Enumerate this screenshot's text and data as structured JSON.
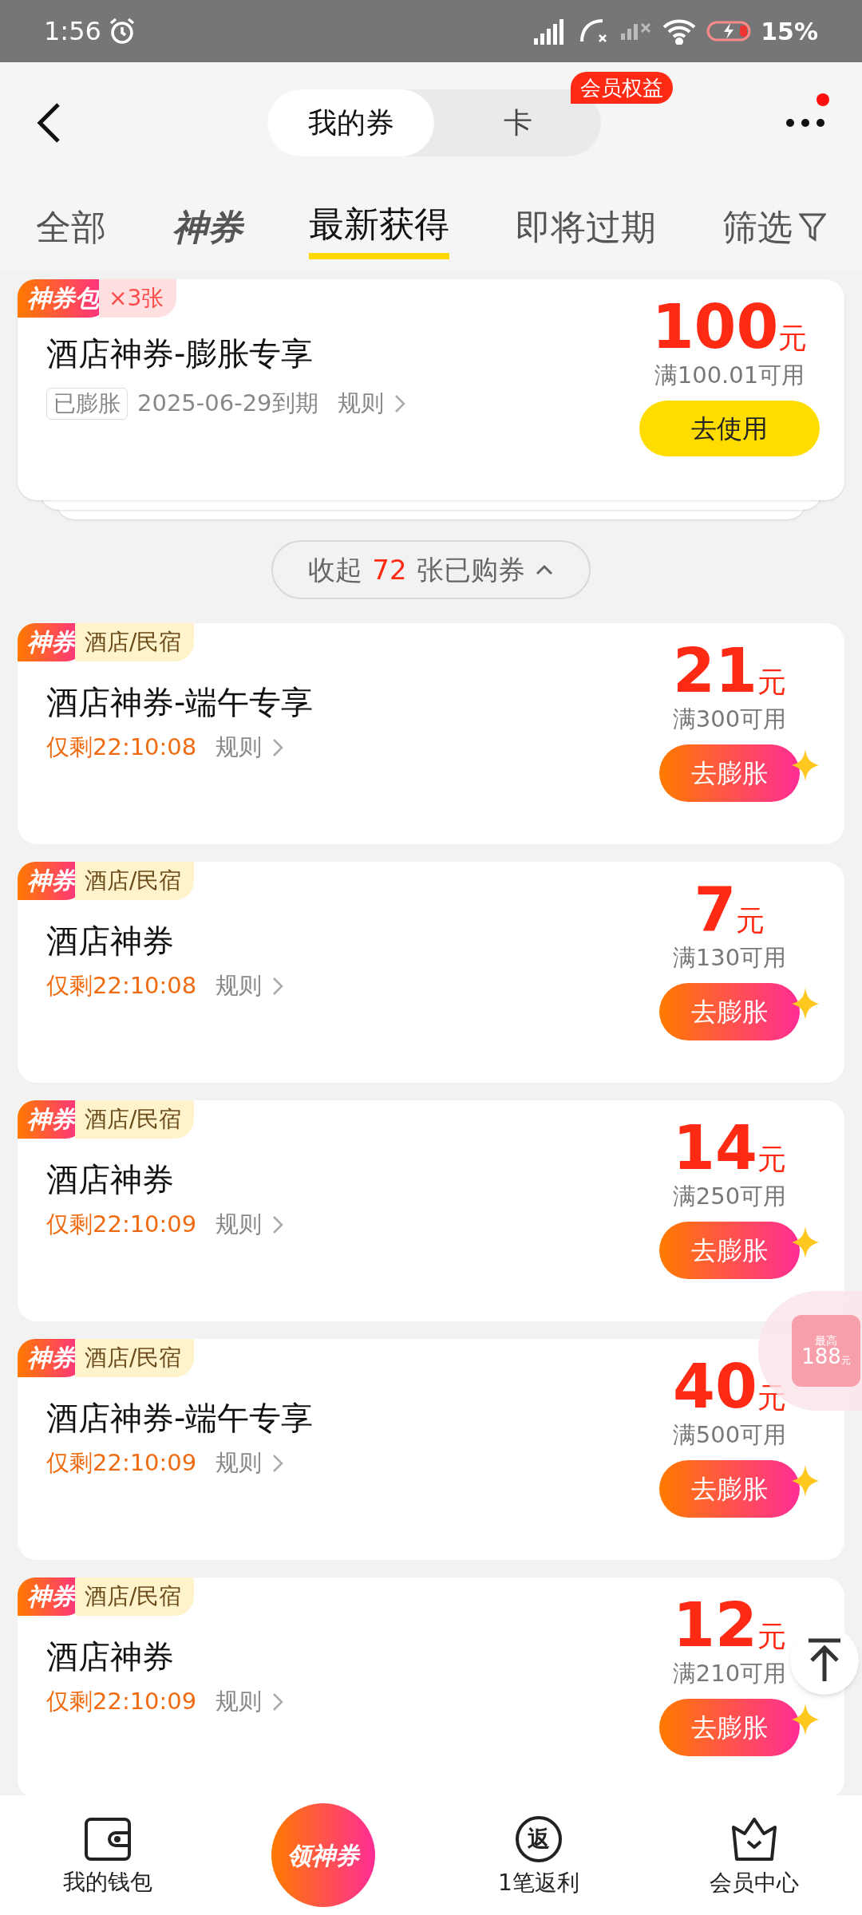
{
  "status_bar": {
    "time": "1:56",
    "battery": "15%"
  },
  "header": {
    "segments": [
      {
        "label": "我的券",
        "selected": true
      },
      {
        "label": "卡",
        "selected": false
      }
    ],
    "badge": "会员权益",
    "has_notification": true
  },
  "tabs": [
    {
      "label": "全部",
      "kind": "text",
      "selected": false
    },
    {
      "label": "神券",
      "kind": "logo",
      "selected": false
    },
    {
      "label": "最新获得",
      "kind": "text",
      "selected": true
    },
    {
      "label": "即将过期",
      "kind": "text",
      "selected": false
    }
  ],
  "filter": "筛选",
  "pack_card": {
    "tag": "神券包",
    "count": "×3张",
    "title": "酒店神券-膨胀专享",
    "badge": "已膨胀",
    "expiry": "2025-06-29到期",
    "rules": "规则",
    "amount": "100",
    "unit": "元",
    "condition": "满100.01可用",
    "button": "去使用"
  },
  "collapse": {
    "prefix": "收起",
    "count": "72",
    "suffix": "张已购券"
  },
  "coupons": [
    {
      "tag": "神券",
      "category": "酒店/民宿",
      "title": "酒店神券-端午专享",
      "countdown": "仅剩22:10:08",
      "rules": "规则",
      "amount": "21",
      "unit": "元",
      "condition": "满300可用",
      "button": "去膨胀"
    },
    {
      "tag": "神券",
      "category": "酒店/民宿",
      "title": "酒店神券",
      "countdown": "仅剩22:10:08",
      "rules": "规则",
      "amount": "7",
      "unit": "元",
      "condition": "满130可用",
      "button": "去膨胀"
    },
    {
      "tag": "神券",
      "category": "酒店/民宿",
      "title": "酒店神券",
      "countdown": "仅剩22:10:09",
      "rules": "规则",
      "amount": "14",
      "unit": "元",
      "condition": "满250可用",
      "button": "去膨胀"
    },
    {
      "tag": "神券",
      "category": "酒店/民宿",
      "title": "酒店神券-端午专享",
      "countdown": "仅剩22:10:09",
      "rules": "规则",
      "amount": "40",
      "unit": "元",
      "condition": "满500可用",
      "button": "去膨胀"
    },
    {
      "tag": "神券",
      "category": "酒店/民宿",
      "title": "酒店神券",
      "countdown": "仅剩22:10:09",
      "rules": "规则",
      "amount": "12",
      "unit": "元",
      "condition": "满210可用",
      "button": "去膨胀"
    }
  ],
  "float_promo": {
    "label": "最高",
    "amount": "188",
    "unit": "元"
  },
  "bottom_nav": [
    {
      "kind": "wallet",
      "label": "我的钱包"
    },
    {
      "kind": "center",
      "label": "领神券"
    },
    {
      "kind": "rebate",
      "icon_text": "返",
      "label": "1笔返利"
    },
    {
      "kind": "crown",
      "label": "会员中心"
    }
  ]
}
